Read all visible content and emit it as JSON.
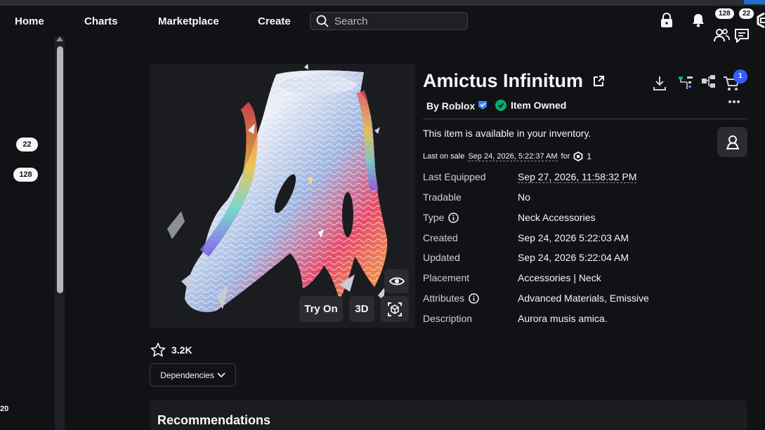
{
  "nav": {
    "home": "Home",
    "charts": "Charts",
    "marketplace": "Marketplace",
    "create": "Create",
    "search_placeholder": "Search",
    "robux_count": "128",
    "notifications_count": "22"
  },
  "sidebar": {
    "badge_friends": "22",
    "badge_robux": "128",
    "bottom_text": "20"
  },
  "item": {
    "title": "Amictus Infinitum",
    "creator": "By Roblox",
    "owned_label": "Item Owned",
    "cart_count": "1",
    "availability": "This item is available in your inventory.",
    "last_sale_prefix": "Last on sale",
    "last_sale_date": "Sep 24, 2026, 5:22:37 AM",
    "last_sale_for": "for",
    "last_sale_price": "1",
    "favorites": "3.2K",
    "dependencies_label": "Dependencies",
    "try_on_label": "Try On",
    "three_d_label": "3D"
  },
  "details": [
    {
      "label": "Last Equipped",
      "value": "Sep 27, 2026, 11:58:32 PM",
      "info": false
    },
    {
      "label": "Tradable",
      "value": "No",
      "info": false
    },
    {
      "label": "Type",
      "value": "Neck Accessories",
      "info": true
    },
    {
      "label": "Created",
      "value": "Sep 24, 2026 5:22:03 AM",
      "info": false
    },
    {
      "label": "Updated",
      "value": "Sep 24, 2026 5:22:04 AM",
      "info": false
    },
    {
      "label": "Placement",
      "value": "Accessories | Neck",
      "info": false
    },
    {
      "label": "Attributes",
      "value": "Advanced Materials, Emissive",
      "info": true
    },
    {
      "label": "Description",
      "value": "Aurora musis amica.",
      "info": false
    }
  ],
  "recommendations": {
    "title": "Recommendations"
  },
  "colors": {
    "background": "#111216",
    "panel": "#1b1c20",
    "accent_blue": "#335fff",
    "owned_green": "#00b06f",
    "verified_blue": "#3b82f6"
  }
}
